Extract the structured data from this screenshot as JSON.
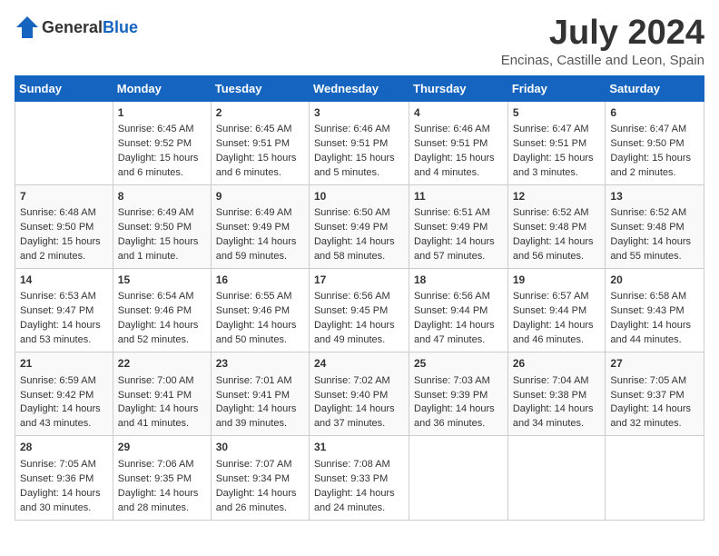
{
  "header": {
    "logo_general": "General",
    "logo_blue": "Blue",
    "month_title": "July 2024",
    "location": "Encinas, Castille and Leon, Spain"
  },
  "calendar": {
    "weekdays": [
      "Sunday",
      "Monday",
      "Tuesday",
      "Wednesday",
      "Thursday",
      "Friday",
      "Saturday"
    ],
    "weeks": [
      [
        {
          "day": "",
          "content": ""
        },
        {
          "day": "1",
          "content": "Sunrise: 6:45 AM\nSunset: 9:52 PM\nDaylight: 15 hours\nand 6 minutes."
        },
        {
          "day": "2",
          "content": "Sunrise: 6:45 AM\nSunset: 9:51 PM\nDaylight: 15 hours\nand 6 minutes."
        },
        {
          "day": "3",
          "content": "Sunrise: 6:46 AM\nSunset: 9:51 PM\nDaylight: 15 hours\nand 5 minutes."
        },
        {
          "day": "4",
          "content": "Sunrise: 6:46 AM\nSunset: 9:51 PM\nDaylight: 15 hours\nand 4 minutes."
        },
        {
          "day": "5",
          "content": "Sunrise: 6:47 AM\nSunset: 9:51 PM\nDaylight: 15 hours\nand 3 minutes."
        },
        {
          "day": "6",
          "content": "Sunrise: 6:47 AM\nSunset: 9:50 PM\nDaylight: 15 hours\nand 2 minutes."
        }
      ],
      [
        {
          "day": "7",
          "content": "Sunrise: 6:48 AM\nSunset: 9:50 PM\nDaylight: 15 hours\nand 2 minutes."
        },
        {
          "day": "8",
          "content": "Sunrise: 6:49 AM\nSunset: 9:50 PM\nDaylight: 15 hours\nand 1 minute."
        },
        {
          "day": "9",
          "content": "Sunrise: 6:49 AM\nSunset: 9:49 PM\nDaylight: 14 hours\nand 59 minutes."
        },
        {
          "day": "10",
          "content": "Sunrise: 6:50 AM\nSunset: 9:49 PM\nDaylight: 14 hours\nand 58 minutes."
        },
        {
          "day": "11",
          "content": "Sunrise: 6:51 AM\nSunset: 9:49 PM\nDaylight: 14 hours\nand 57 minutes."
        },
        {
          "day": "12",
          "content": "Sunrise: 6:52 AM\nSunset: 9:48 PM\nDaylight: 14 hours\nand 56 minutes."
        },
        {
          "day": "13",
          "content": "Sunrise: 6:52 AM\nSunset: 9:48 PM\nDaylight: 14 hours\nand 55 minutes."
        }
      ],
      [
        {
          "day": "14",
          "content": "Sunrise: 6:53 AM\nSunset: 9:47 PM\nDaylight: 14 hours\nand 53 minutes."
        },
        {
          "day": "15",
          "content": "Sunrise: 6:54 AM\nSunset: 9:46 PM\nDaylight: 14 hours\nand 52 minutes."
        },
        {
          "day": "16",
          "content": "Sunrise: 6:55 AM\nSunset: 9:46 PM\nDaylight: 14 hours\nand 50 minutes."
        },
        {
          "day": "17",
          "content": "Sunrise: 6:56 AM\nSunset: 9:45 PM\nDaylight: 14 hours\nand 49 minutes."
        },
        {
          "day": "18",
          "content": "Sunrise: 6:56 AM\nSunset: 9:44 PM\nDaylight: 14 hours\nand 47 minutes."
        },
        {
          "day": "19",
          "content": "Sunrise: 6:57 AM\nSunset: 9:44 PM\nDaylight: 14 hours\nand 46 minutes."
        },
        {
          "day": "20",
          "content": "Sunrise: 6:58 AM\nSunset: 9:43 PM\nDaylight: 14 hours\nand 44 minutes."
        }
      ],
      [
        {
          "day": "21",
          "content": "Sunrise: 6:59 AM\nSunset: 9:42 PM\nDaylight: 14 hours\nand 43 minutes."
        },
        {
          "day": "22",
          "content": "Sunrise: 7:00 AM\nSunset: 9:41 PM\nDaylight: 14 hours\nand 41 minutes."
        },
        {
          "day": "23",
          "content": "Sunrise: 7:01 AM\nSunset: 9:41 PM\nDaylight: 14 hours\nand 39 minutes."
        },
        {
          "day": "24",
          "content": "Sunrise: 7:02 AM\nSunset: 9:40 PM\nDaylight: 14 hours\nand 37 minutes."
        },
        {
          "day": "25",
          "content": "Sunrise: 7:03 AM\nSunset: 9:39 PM\nDaylight: 14 hours\nand 36 minutes."
        },
        {
          "day": "26",
          "content": "Sunrise: 7:04 AM\nSunset: 9:38 PM\nDaylight: 14 hours\nand 34 minutes."
        },
        {
          "day": "27",
          "content": "Sunrise: 7:05 AM\nSunset: 9:37 PM\nDaylight: 14 hours\nand 32 minutes."
        }
      ],
      [
        {
          "day": "28",
          "content": "Sunrise: 7:05 AM\nSunset: 9:36 PM\nDaylight: 14 hours\nand 30 minutes."
        },
        {
          "day": "29",
          "content": "Sunrise: 7:06 AM\nSunset: 9:35 PM\nDaylight: 14 hours\nand 28 minutes."
        },
        {
          "day": "30",
          "content": "Sunrise: 7:07 AM\nSunset: 9:34 PM\nDaylight: 14 hours\nand 26 minutes."
        },
        {
          "day": "31",
          "content": "Sunrise: 7:08 AM\nSunset: 9:33 PM\nDaylight: 14 hours\nand 24 minutes."
        },
        {
          "day": "",
          "content": ""
        },
        {
          "day": "",
          "content": ""
        },
        {
          "day": "",
          "content": ""
        }
      ]
    ]
  }
}
